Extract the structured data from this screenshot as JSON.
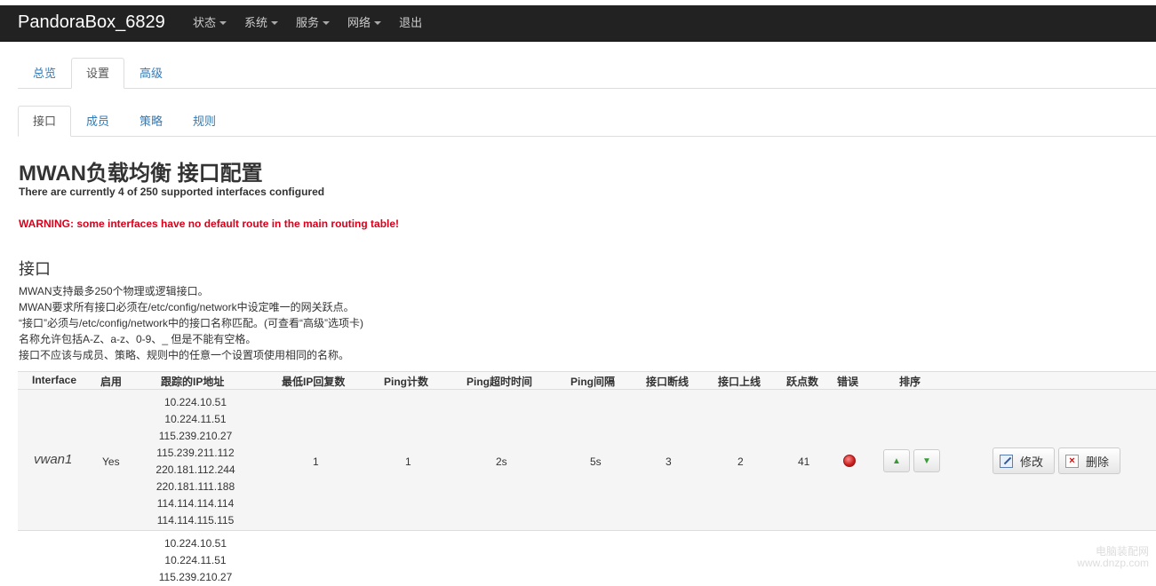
{
  "header": {
    "brand": "PandoraBox_6829",
    "nav": [
      "状态",
      "系统",
      "服务",
      "网络",
      "退出"
    ]
  },
  "tabs_main": [
    "总览",
    "设置",
    "高级"
  ],
  "tabs_sub": [
    "接口",
    "成员",
    "策略",
    "规则"
  ],
  "page": {
    "title": "MWAN负载均衡 接口配置",
    "subtitle": "There are currently 4 of 250 supported interfaces configured",
    "warning": "WARNING: some interfaces have no default route in the main routing table!"
  },
  "section": {
    "title": "接口",
    "desc": [
      "MWAN支持最多250个物理或逻辑接口。",
      "MWAN要求所有接口必须在/etc/config/network中设定唯一的网关跃点。",
      "“接口”必须与/etc/config/network中的接口名称匹配。(可查看“高级”选项卡)",
      "名称允许包括A-Z、a-z、0-9、_ 但是不能有空格。",
      "接口不应该与成员、策略、规则中的任意一个设置项使用相同的名称。"
    ]
  },
  "table": {
    "headers": [
      "Interface",
      "启用",
      "跟踪的IP地址",
      "最低IP回复数",
      "Ping计数",
      "Ping超时时间",
      "Ping间隔",
      "接口断线",
      "接口上线",
      "跃点数",
      "错误",
      "排序"
    ],
    "rows": [
      {
        "interface": "vwan1",
        "enabled": "Yes",
        "ips": [
          "10.224.10.51",
          "10.224.11.51",
          "115.239.210.27",
          "115.239.211.112",
          "220.181.112.244",
          "220.181.111.188",
          "114.114.114.114",
          "114.114.115.115"
        ],
        "min_reply": "1",
        "ping_count": "1",
        "ping_timeout": "2s",
        "ping_interval": "5s",
        "down": "3",
        "up": "2",
        "metric": "41"
      }
    ],
    "row2_ips": [
      "10.224.10.51",
      "10.224.11.51",
      "115.239.210.27"
    ],
    "edit_label": "修改",
    "delete_label": "删除"
  },
  "watermark": [
    "电脑装配网",
    "www.dnzp.com"
  ]
}
